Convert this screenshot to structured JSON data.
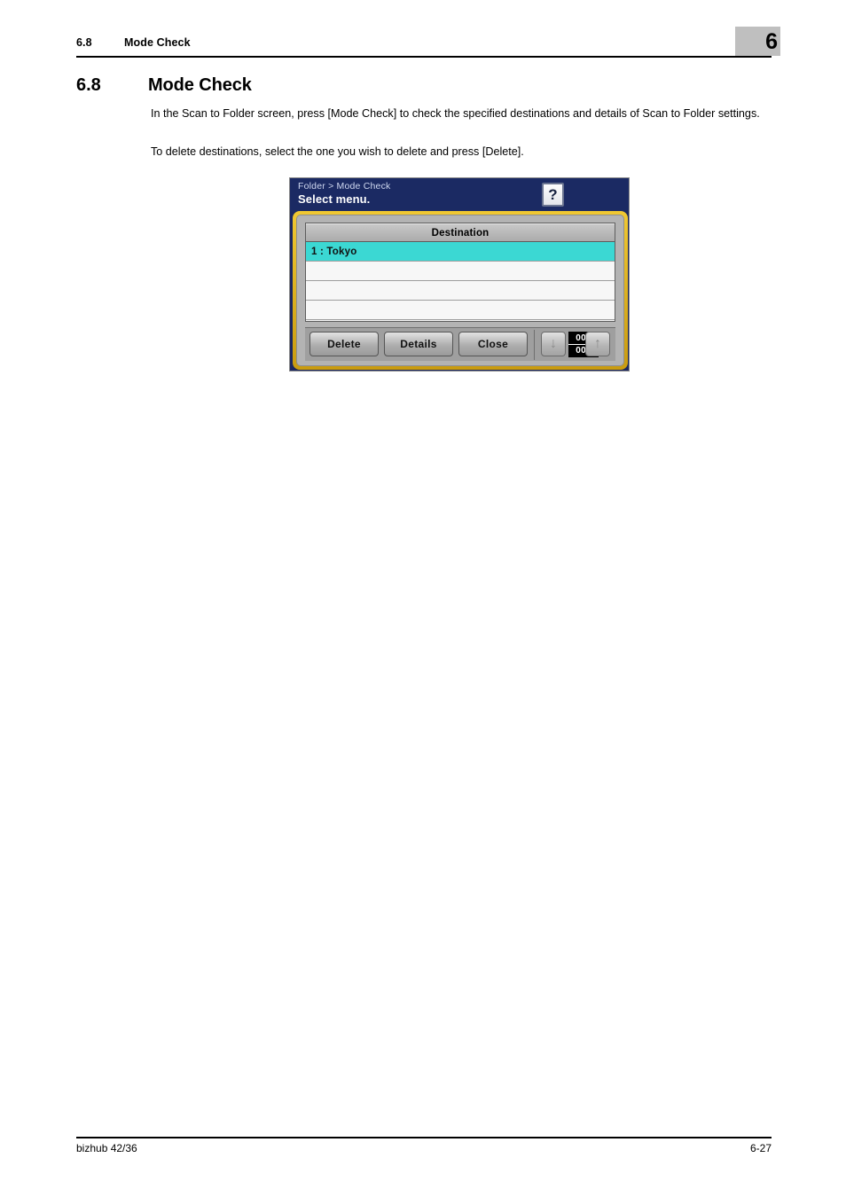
{
  "header": {
    "section_number": "6.8",
    "section_title": "Mode Check",
    "chapter_number": "6"
  },
  "section": {
    "number": "6.8",
    "title": "Mode Check"
  },
  "body": {
    "paragraph_1": "In the Scan to Folder screen, press [Mode Check] to check the specified destinations and details of Scan to Folder settings.",
    "paragraph_2": "To delete destinations, select the one you wish to delete and press [Delete]."
  },
  "device_panel": {
    "breadcrumb": "Folder > Mode Check",
    "prompt": "Select menu.",
    "help_icon": "?",
    "list": {
      "column_header": "Destination",
      "rows": [
        {
          "label": "1 : Tokyo",
          "selected": true
        },
        {
          "label": "",
          "selected": false
        },
        {
          "label": "",
          "selected": false
        },
        {
          "label": "",
          "selected": false
        }
      ]
    },
    "buttons": {
      "delete": "Delete",
      "details": "Details",
      "close": "Close"
    },
    "navigation": {
      "down_arrow": "↓",
      "up_arrow": "↑",
      "current_page": "001",
      "total_pages": "001"
    },
    "colors": {
      "titlebar": "#1b2a63",
      "frame_gold": "#e8b923",
      "selected_row": "#3bd8d3",
      "panel_gray": "#b3b3b3"
    }
  },
  "footer": {
    "model": "bizhub 42/36",
    "page_number": "6-27"
  }
}
